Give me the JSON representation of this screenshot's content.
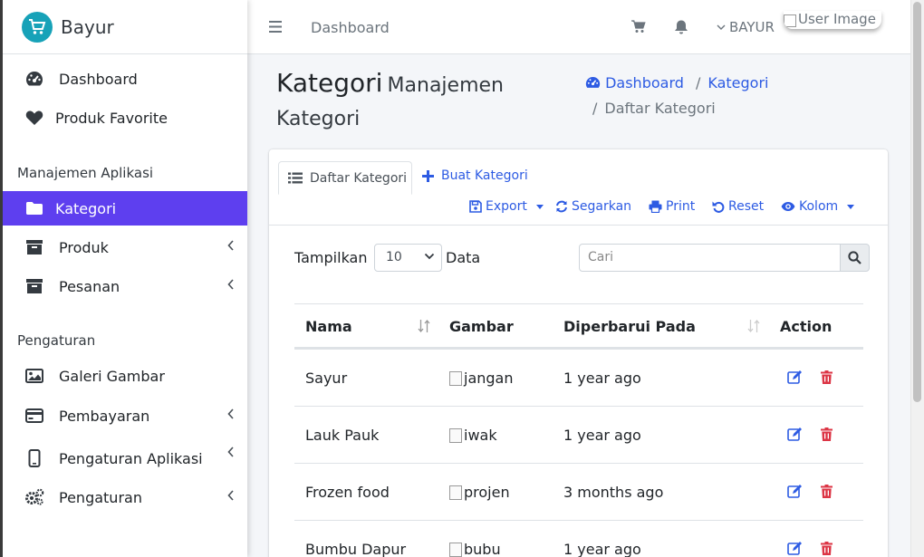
{
  "brand": {
    "name": "Bayur",
    "logo_icon": "cart-icon",
    "accent": "#17a2b8"
  },
  "sidebar": {
    "items": [
      {
        "label": "Dashboard",
        "icon": "tachometer-icon"
      },
      {
        "label": "Produk Favorite",
        "icon": "heart-icon"
      }
    ],
    "section_apps": "Manajemen Aplikasi",
    "apps_items": [
      {
        "label": "Kategori",
        "icon": "folder-icon",
        "active": true
      },
      {
        "label": "Produk",
        "icon": "archive-icon"
      },
      {
        "label": "Pesanan",
        "icon": "archive-icon"
      }
    ],
    "section_settings": "Pengaturan",
    "settings_items": [
      {
        "label": "Galeri Gambar",
        "icon": "image-icon"
      },
      {
        "label": "Pembayaran",
        "icon": "credit-card-icon"
      },
      {
        "label": "Pengaturan Aplikasi",
        "icon": "mobile-icon"
      },
      {
        "label": "Pengaturan",
        "icon": "cogs-icon"
      }
    ],
    "active_color": "#5e3fef"
  },
  "topbar": {
    "nav_link": "Dashboard",
    "user_name": "BAYUR",
    "user_image_alt": "User Image"
  },
  "header": {
    "title": "Kategori",
    "subtitle": "Manajemen Kategori",
    "breadcrumb": {
      "home": "Dashboard",
      "current_parent": "Kategori",
      "current": "Daftar Kategori"
    }
  },
  "card": {
    "tab_active": "Daftar Kategori",
    "tab_create": "Buat Kategori",
    "toolbar": {
      "export": "Export",
      "refresh": "Segarkan",
      "print": "Print",
      "reset": "Reset",
      "columns": "Kolom"
    },
    "show_label": "Tampilkan",
    "page_size": "10",
    "data_label": "Data",
    "search_placeholder": "Cari",
    "columns": [
      "Nama",
      "Gambar",
      "Diperbarui Pada",
      "Action"
    ],
    "rows": [
      {
        "name": "Sayur",
        "image_alt": "jangan",
        "updated": "1 year ago"
      },
      {
        "name": "Lauk Pauk",
        "image_alt": "iwak",
        "updated": "1 year ago"
      },
      {
        "name": "Frozen food",
        "image_alt": "projen",
        "updated": "3 months ago"
      },
      {
        "name": "Bumbu Dapur",
        "image_alt": "bubu",
        "updated": "1 year ago"
      }
    ],
    "link_color": "#2d5be3",
    "delete_color": "#dc3545"
  }
}
